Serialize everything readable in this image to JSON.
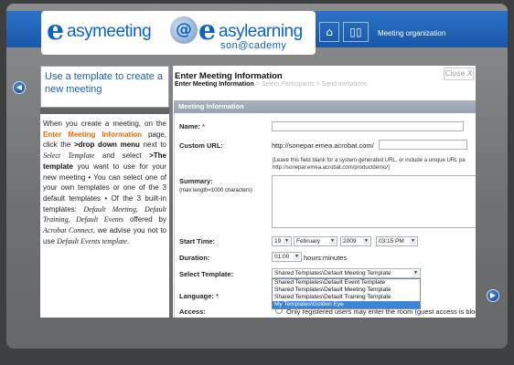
{
  "banner": {
    "logo_e1": "e",
    "logo_word1": "asymeeting",
    "logo_at": "@",
    "logo_e2": "e",
    "logo_word2": "asylearning",
    "logo_sub": "son@cademy",
    "title": "Meeting organization"
  },
  "left_panel": {
    "title": "Use a template to create a new meeting",
    "body": {
      "p1": "When you create a meeting, on the ",
      "link": "Enter Meeting Information",
      "p2": " page, click the ",
      "b1": ">drop down menu",
      "p3": " next to ",
      "i1": "Select Template",
      "p4": " and select ",
      "b2": ">The template",
      "p5": " you want to use for your new meeting • You can select one of your own templates or one of the 3 default templates • Of the 3 built-in templates: ",
      "i2": "Default Meeting, Default Training, Default Events",
      "p6": " offered by ",
      "i3": "Acrobat Connect",
      "p7": ", we advise you not to use ",
      "i4": "Default Events template",
      "p8": "."
    }
  },
  "dialog": {
    "title": "Enter Meeting Information",
    "crumb_current": "Enter Meeting Information",
    "crumb_rest": " > Select Participants > Send Invitations",
    "close_label": "Close X",
    "section_header": "Meeting Information",
    "fields": {
      "name_label": "Name:",
      "name_req": "*",
      "url_label": "Custom URL:",
      "url_prefix": "http://sonepar.emea.acrobat.com/",
      "url_hint1": "[Leave this field blank for a system-generated URL, or include a unique URL pa",
      "url_hint2": "http://sonepar.emea.acrobat.com/productdemo/]",
      "summary_label": "Summary:",
      "summary_hint": "(max length=1000 characters)",
      "start_label": "Start Time:",
      "start_day": "19",
      "start_month": "February",
      "start_year": "2009",
      "start_time": "03:15 PM",
      "duration_label": "Duration:",
      "duration_value": "01:00",
      "duration_unit": "hours:minutes",
      "template_label": "Select Template:",
      "template_selected": "Shared Templates\\Default Meeting Template",
      "template_options": [
        "Shared Templates\\Default Event Template",
        "Shared Templates\\Default Meeting Template",
        "Shared Templates\\Default Training Template",
        "My Templates\\Golden Eye"
      ],
      "template_active_index": 3,
      "language_label": "Language:",
      "language_req": "*",
      "access_label": "Access:",
      "access_option": "Only registered users may enter the room (guest access is block"
    }
  },
  "nav": {
    "prev_icon": "◀",
    "next_icon": "▶"
  }
}
